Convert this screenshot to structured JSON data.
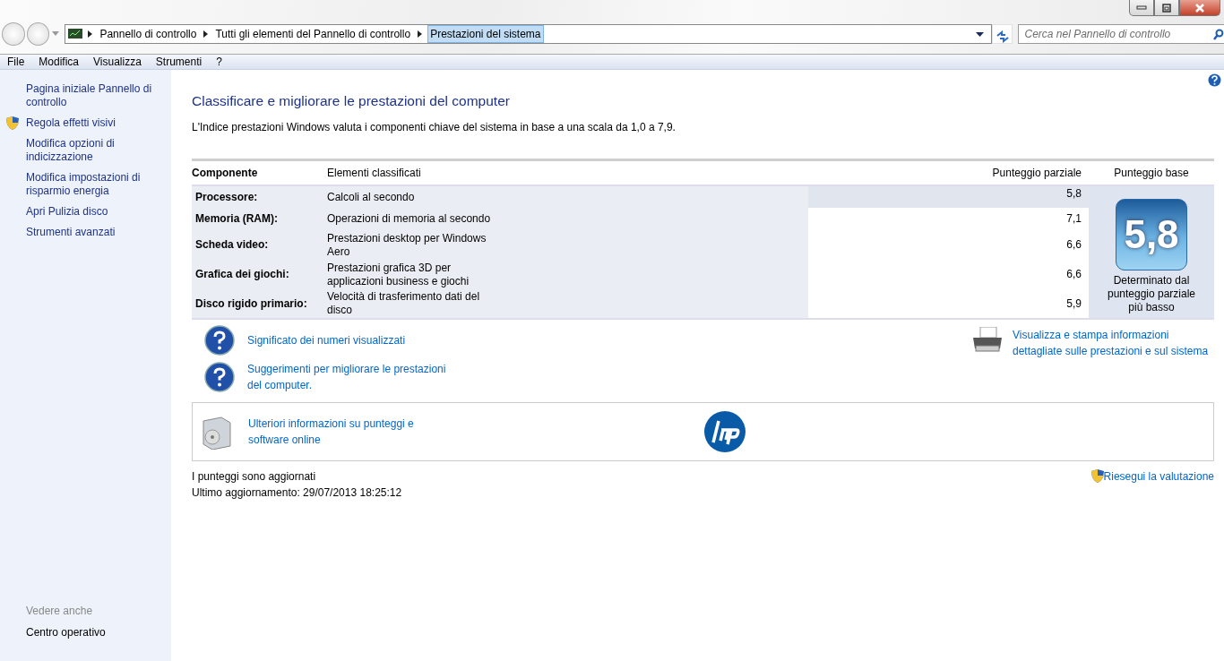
{
  "address_bar": {
    "breadcrumbs": [
      "Pannello di controllo",
      "Tutti gli elementi del Pannello di controllo",
      "Prestazioni del sistema"
    ],
    "search_placeholder": "Cerca nel Pannello di controllo"
  },
  "menu": [
    "File",
    "Modifica",
    "Visualizza",
    "Strumenti",
    "?"
  ],
  "sidebar": {
    "items": [
      {
        "label": "Pagina iniziale Pannello di controllo",
        "shield": false
      },
      {
        "label": "Regola effetti visivi",
        "shield": true
      },
      {
        "label": "Modifica opzioni di indicizzazione",
        "shield": false
      },
      {
        "label": "Modifica impostazioni di risparmio energia",
        "shield": false
      },
      {
        "label": "Apri Pulizia disco",
        "shield": false
      },
      {
        "label": "Strumenti avanzati",
        "shield": false
      }
    ],
    "see_also_heading": "Vedere anche",
    "see_also": [
      "Centro operativo"
    ]
  },
  "content": {
    "title": "Classificare e migliorare le prestazioni del computer",
    "description": "L'Indice prestazioni Windows valuta i componenti chiave del sistema in base a una scala da 1,0 a 7,9.",
    "table": {
      "columns": [
        "Componente",
        "Elementi classificati",
        "Punteggio parziale",
        "Punteggio base"
      ],
      "rows": [
        {
          "component": "Processore:",
          "rated": "Calcoli al secondo",
          "subscore": "5,8",
          "lowest": true
        },
        {
          "component": "Memoria (RAM):",
          "rated": "Operazioni di memoria al secondo",
          "subscore": "7,1",
          "lowest": false
        },
        {
          "component": "Scheda video:",
          "rated": "Prestazioni desktop per Windows Aero",
          "subscore": "6,6",
          "lowest": false
        },
        {
          "component": "Grafica dei giochi:",
          "rated": "Prestazioni grafica 3D per applicazioni business e giochi",
          "subscore": "6,6",
          "lowest": false
        },
        {
          "component": "Disco rigido primario:",
          "rated": "Velocità di trasferimento dati del disco",
          "subscore": "5,9",
          "lowest": false
        }
      ],
      "base_score": "5,8",
      "base_note": "Determinato dal punteggio parziale più basso"
    },
    "help_links": [
      "Significato dei numeri visualizzati",
      "Suggerimenti per migliorare le prestazioni del computer."
    ],
    "print_link": "Visualizza e stampa informazioni dettagliate sulle prestazioni e sul sistema",
    "online_link": "Ulteriori informazioni su punteggi e software online",
    "status": [
      "I punteggi sono aggiornati",
      "Ultimo aggiornamento: 29/07/2013 18:25:12"
    ],
    "rerun_link": "Riesegui la valutazione"
  }
}
